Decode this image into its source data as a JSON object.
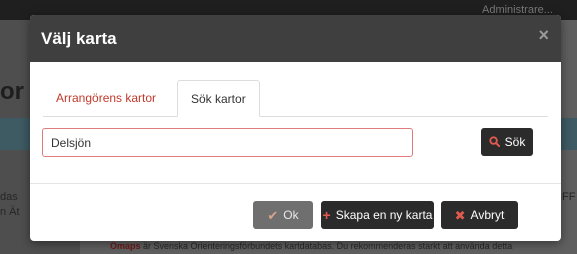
{
  "background": {
    "user_name": "Administrare...",
    "heading_fragment": "or",
    "left_text_1": "das",
    "left_text_2": "n Ät",
    "right_text": "IFF",
    "footer_brand": "Omaps",
    "footer_text": " är Svenska Orienteringsförbundets kartdatabas. Du rekommenderas starkt att använda detta"
  },
  "modal": {
    "title": "Välj karta",
    "close_glyph": "×",
    "tabs": [
      {
        "label": "Arrangörens kartor",
        "active": false
      },
      {
        "label": "Sök kartor",
        "active": true
      }
    ],
    "search": {
      "value": "Delsjön",
      "button_label": "Sök",
      "icon": "search-icon"
    },
    "footer": {
      "ok_label": "Ok",
      "create_label": "Skapa en ny karta",
      "cancel_label": "Avbryt"
    }
  },
  "colors": {
    "header_bg": "#3f3f3f",
    "accent_red": "#c0392b",
    "button_dark": "#2b2b2b",
    "button_disabled": "#6f6f6f"
  }
}
